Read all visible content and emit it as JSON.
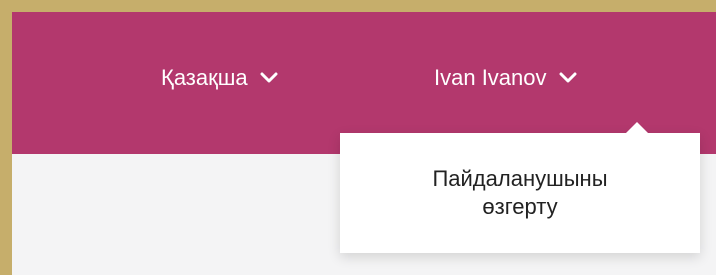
{
  "header": {
    "background_color": "#b3386d",
    "language_selector": {
      "label": "Қазақша",
      "icon": "chevron-down-icon"
    },
    "user_menu": {
      "name": "Ivan Ivanov",
      "icon": "chevron-down-icon",
      "dropdown": {
        "items": [
          {
            "label": "Пайдаланушыны өзгерту"
          }
        ]
      }
    }
  },
  "colors": {
    "accent": "#b3386d",
    "border": "#c6ae6b",
    "content_bg": "#f4f4f5"
  }
}
